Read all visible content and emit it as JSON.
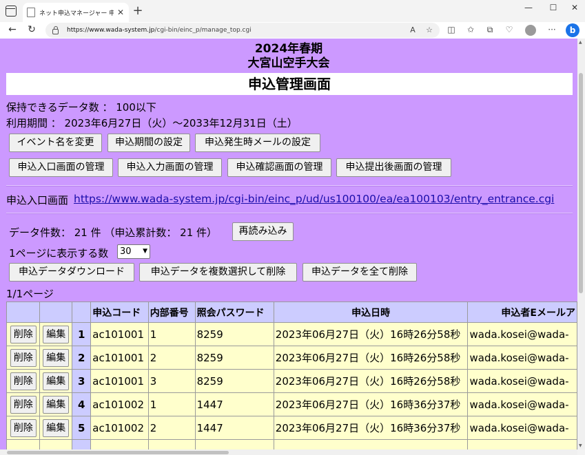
{
  "browser": {
    "tab_title": "ネット申込マネージャー 申込管理画面",
    "url_host": "https://www.wada-system.jp",
    "url_path": "/cgi-bin/einc_p/manage_top.cgi"
  },
  "event": {
    "line1": "2024年春期",
    "line2": "大宮山空手大会"
  },
  "page_title": "申込管理画面",
  "info": {
    "capacity": "保持できるデータ数 ： 100以下",
    "period": "利用期間 ： 2023年6月27日（火）～2033年12月31日（土）"
  },
  "buttons": {
    "row1": [
      "イベント名を変更",
      "申込期間の設定",
      "申込発生時メールの設定"
    ],
    "row2": [
      "申込入口画面の管理",
      "申込入力画面の管理",
      "申込確認画面の管理",
      "申込提出後画面の管理"
    ]
  },
  "entrance": {
    "label": "申込入口画面",
    "url": "https://www.wada-system.jp/cgi-bin/einc_p/ud/us100100/ea/ea100103/entry_entrance.cgi"
  },
  "stats": {
    "count_text": "データ件数： 21 件 （申込累計数： 21 件）",
    "reload": "再読み込み",
    "per_page_label": "1ページに表示する数",
    "per_page_value": "30"
  },
  "actions": [
    "申込データダウンロード",
    "申込データを複数選択して削除",
    "申込データを全て削除"
  ],
  "pager": "1/1ページ",
  "table": {
    "headers": [
      "申込コード",
      "内部番号",
      "照会パスワード",
      "申込日時",
      "申込者Eメールア"
    ],
    "delete_label": "削除",
    "edit_label": "編集",
    "rows": [
      {
        "no": "1",
        "code": "ac101001",
        "internal": "1",
        "password": "8259",
        "date": "2023年06月27日（火）16時26分58秒",
        "email": "wada.kosei@wada-"
      },
      {
        "no": "2",
        "code": "ac101001",
        "internal": "2",
        "password": "8259",
        "date": "2023年06月27日（火）16時26分58秒",
        "email": "wada.kosei@wada-"
      },
      {
        "no": "3",
        "code": "ac101001",
        "internal": "3",
        "password": "8259",
        "date": "2023年06月27日（火）16時26分58秒",
        "email": "wada.kosei@wada-"
      },
      {
        "no": "4",
        "code": "ac101002",
        "internal": "1",
        "password": "1447",
        "date": "2023年06月27日（火）16時36分37秒",
        "email": "wada.kosei@wada-"
      },
      {
        "no": "5",
        "code": "ac101002",
        "internal": "2",
        "password": "1447",
        "date": "2023年06月27日（火）16時36分37秒",
        "email": "wada.kosei@wada-"
      }
    ]
  },
  "colors": {
    "page_bg": "#cc99ff",
    "header_bg": "#ccccff",
    "cell_bg": "#ffffcc",
    "link": "#1a0dab"
  }
}
